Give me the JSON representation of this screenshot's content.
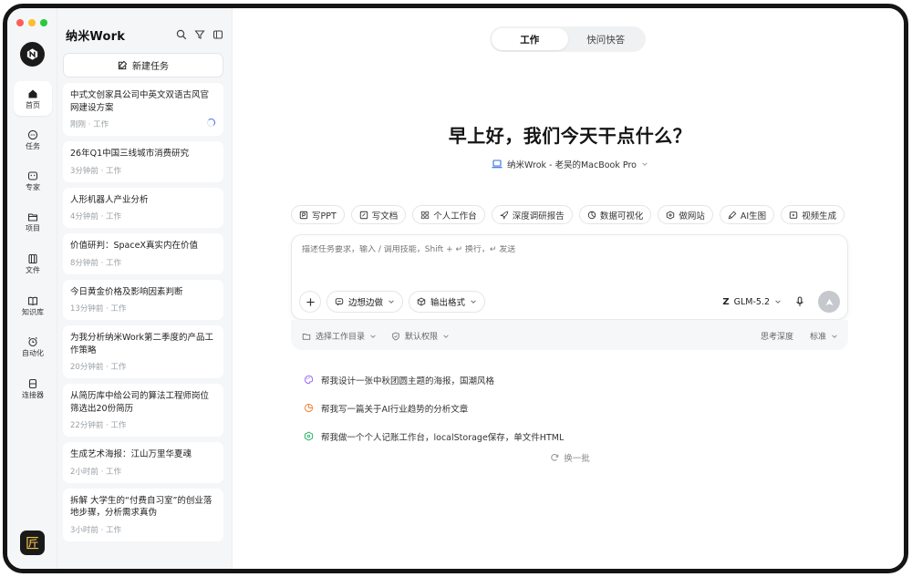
{
  "rail": {
    "items": [
      {
        "label": "首页",
        "icon": "home-icon"
      },
      {
        "label": "任务",
        "icon": "chat-icon"
      },
      {
        "label": "专家",
        "icon": "expert-icon"
      },
      {
        "label": "项目",
        "icon": "folder-icon"
      },
      {
        "label": "文件",
        "icon": "file-icon"
      },
      {
        "label": "知识库",
        "icon": "book-icon"
      },
      {
        "label": "自动化",
        "icon": "alarm-icon"
      },
      {
        "label": "连接器",
        "icon": "connector-icon"
      }
    ],
    "bottom_badge": "匠"
  },
  "sidebar": {
    "title": "纳米Work",
    "new_task_label": "新建任务",
    "tasks": [
      {
        "title": "中式文创家具公司中英文双语古风官网建设方案",
        "meta": "刚刚 · 工作",
        "loading": true
      },
      {
        "title": "26年Q1中国三线城市消费研究",
        "meta": "3分钟前 · 工作"
      },
      {
        "title": "人形机器人产业分析",
        "meta": "4分钟前 · 工作"
      },
      {
        "title": "价值研判：SpaceX真实内在价值",
        "meta": "8分钟前 · 工作"
      },
      {
        "title": "今日黄金价格及影响因素判断",
        "meta": "13分钟前 · 工作"
      },
      {
        "title": "为我分析纳米Work第二季度的产品工作策略",
        "meta": "20分钟前 · 工作"
      },
      {
        "title": "从简历库中给公司的算法工程师岗位筛选出20份简历",
        "meta": "22分钟前 · 工作"
      },
      {
        "title": "生成艺术海报：江山万里华夏魂",
        "meta": "2小时前 · 工作"
      },
      {
        "title": "拆解 大学生的“付费自习室”的创业落地步骤，分析需求真伪",
        "meta": "3小时前 · 工作"
      }
    ]
  },
  "main": {
    "tabs": [
      {
        "label": "工作",
        "active": true
      },
      {
        "label": "快问快答",
        "active": false
      }
    ],
    "greeting": "早上好，我们今天干点什么？",
    "device": "纳米Wrok - 老吴的MacBook Pro",
    "chips": [
      {
        "label": "写PPT",
        "icon": "ppt-icon"
      },
      {
        "label": "写文档",
        "icon": "doc-icon"
      },
      {
        "label": "个人工作台",
        "icon": "grid-icon"
      },
      {
        "label": "深度调研报告",
        "icon": "rocket-icon"
      },
      {
        "label": "数据可视化",
        "icon": "chart-icon"
      },
      {
        "label": "做网站",
        "icon": "box-icon"
      },
      {
        "label": "AI生图",
        "icon": "brush-icon"
      },
      {
        "label": "视频生成",
        "icon": "video-icon"
      }
    ],
    "composer": {
      "placeholder": "描述任务要求，输入 / 调用技能，Shift + ↵ 换行，↵ 发送",
      "mode_label": "边想边做",
      "format_label": "输出格式",
      "model_label": "GLM-5.2",
      "model_mark": "Z"
    },
    "subbar": {
      "dir_label": "选择工作目录",
      "perm_label": "默认权限",
      "thinking_label": "思考深度",
      "level_label": "标准"
    },
    "suggestions": [
      {
        "text": "帮我设计一张中秋团圆主题的海报，国潮风格",
        "icon": "paint-icon",
        "color": "#9b6cf0"
      },
      {
        "text": "帮我写一篇关于AI行业趋势的分析文章",
        "icon": "pie-icon",
        "color": "#f0883e"
      },
      {
        "text": "帮我做一个个人记账工作台，localStorage保存，单文件HTML",
        "icon": "box-icon",
        "color": "#2fb36b"
      }
    ],
    "refresh_label": "换一批"
  },
  "colors": {
    "accent": "#3d6cf0",
    "sidebar_bg": "#f5f6f8",
    "traffic_red": "#fe5f57",
    "traffic_yellow": "#febc2e",
    "traffic_green": "#28c840"
  }
}
